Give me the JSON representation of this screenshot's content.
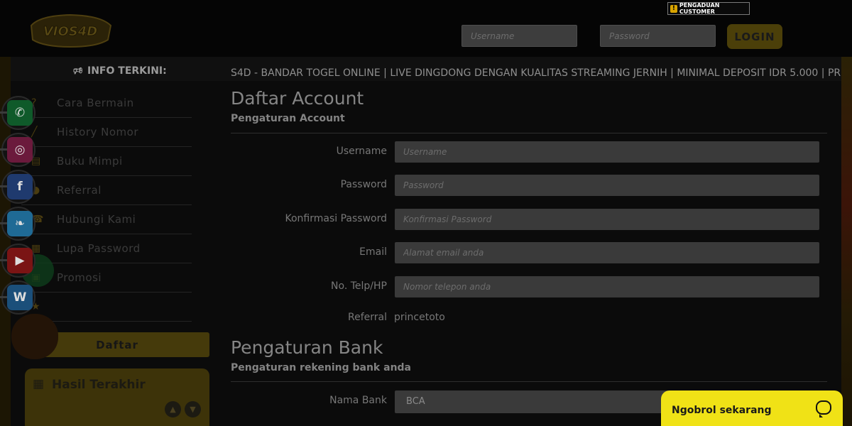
{
  "header": {
    "logo_text": "VIOS4D",
    "complaint_label": "PENGADUAN CUSTOMER",
    "username_placeholder": "Username",
    "password_placeholder": "Password",
    "login_label": "LOGIN"
  },
  "info_bar": {
    "label": "INFO TERKINI:",
    "marquee": "S4D - BANDAR TOGEL ONLINE | LIVE DINGDONG DENGAN KUALITAS STREAMING JERNIH | MINIMAL DEPOSIT IDR 5.000 | PR"
  },
  "sidebar": {
    "items": [
      {
        "label": "Cara Bermain",
        "icon": "question-icon"
      },
      {
        "label": "History Nomor",
        "icon": "chart-icon"
      },
      {
        "label": "Buku Mimpi",
        "icon": "book-icon"
      },
      {
        "label": "Referral",
        "icon": "users-icon"
      },
      {
        "label": "Hubungi Kami",
        "icon": "phone-icon"
      },
      {
        "label": "Lupa Password",
        "icon": "calendar-icon"
      },
      {
        "label": "Promosi",
        "icon": "gift-icon"
      },
      {
        "label": "",
        "icon": "star-icon"
      }
    ],
    "daftar_label": "Daftar",
    "hasil_title": "Hasil Terakhir"
  },
  "socials": [
    "whatsapp-icon",
    "instagram-icon",
    "facebook-icon",
    "twitter-icon",
    "youtube-icon",
    "wordpress-icon"
  ],
  "account": {
    "title": "Daftar Account",
    "subtitle": "Pengaturan Account",
    "fields": {
      "username": {
        "label": "Username",
        "placeholder": "Username"
      },
      "password": {
        "label": "Password",
        "placeholder": "Password"
      },
      "confirm": {
        "label": "Konfirmasi Password",
        "placeholder": "Konfirmasi Password"
      },
      "email": {
        "label": "Email",
        "placeholder": "Alamat email anda"
      },
      "phone": {
        "label": "No. Telp/HP",
        "placeholder": "Nomor telepon anda"
      },
      "referral": {
        "label": "Referral",
        "value": "princetoto"
      }
    }
  },
  "bank": {
    "title": "Pengaturan Bank",
    "subtitle": "Pengaturan rekening bank anda",
    "bank_name": {
      "label": "Nama Bank",
      "value": "BCA"
    }
  },
  "chat": {
    "label": "Ngobrol sekarang"
  },
  "colors": {
    "accent": "#f0e216",
    "dim_gold": "#453a0b"
  }
}
